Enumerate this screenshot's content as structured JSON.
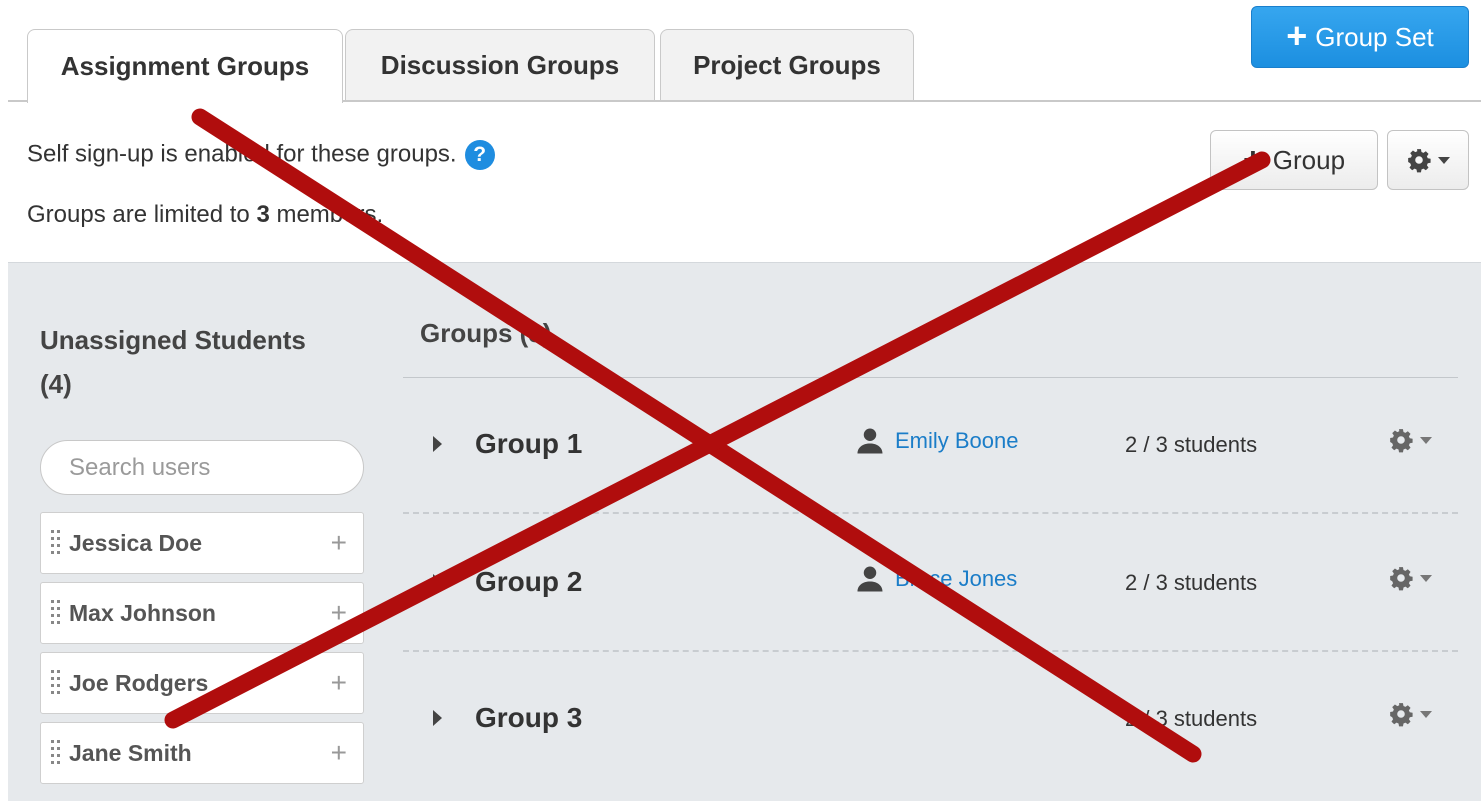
{
  "tabs": [
    {
      "label": "Assignment Groups",
      "active": true
    },
    {
      "label": "Discussion Groups",
      "active": false
    },
    {
      "label": "Project Groups",
      "active": false
    }
  ],
  "toolbar": {
    "group_set_label": "Group Set",
    "group_label": "Group"
  },
  "info": {
    "self_signup": "Self sign-up is enabled for these groups.",
    "limit_prefix": "Groups are limited to ",
    "limit_number": "3",
    "limit_suffix": " members."
  },
  "unassigned": {
    "title": "Unassigned Students",
    "count": "(4)",
    "search_placeholder": "Search users",
    "students": [
      "Jessica Doe",
      "Max Johnson",
      "Joe Rodgers",
      "Jane Smith"
    ]
  },
  "groups": {
    "title": "Groups (3)",
    "items": [
      {
        "name": "Group 1",
        "leader": "Emily Boone",
        "count": "2 / 3 students"
      },
      {
        "name": "Group 2",
        "leader": "Bruce Jones",
        "count": "2 / 3 students"
      },
      {
        "name": "Group 3",
        "leader": "",
        "count": "2 / 3 students"
      }
    ]
  },
  "colors": {
    "primary_button": "#1c8fe0",
    "link": "#1b7dc8",
    "panel_bg": "#e6e9ec",
    "cross": "#b00d0d"
  },
  "icons": {
    "help": "question-circle-icon",
    "settings": "gear-icon",
    "user": "user-icon",
    "add": "plus-icon",
    "expand": "caret-right-icon",
    "drag": "drag-handle-icon",
    "overlay": "red-x-overlay"
  }
}
